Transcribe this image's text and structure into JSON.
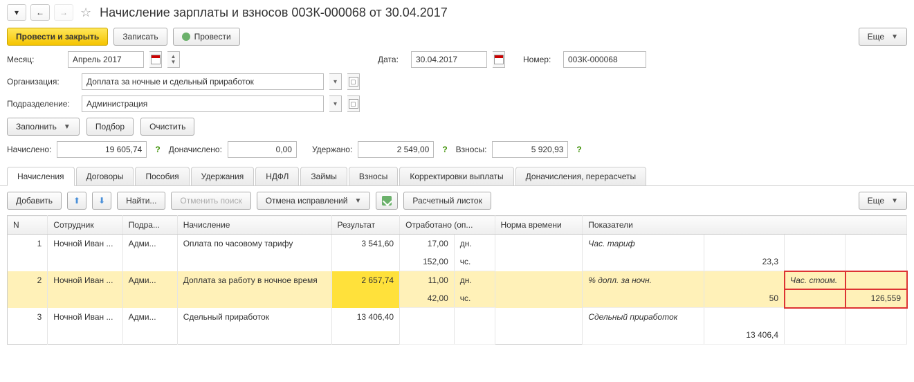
{
  "header": {
    "title": "Начисление зарплаты и взносов 00ЗК-000068 от 30.04.2017"
  },
  "toolbar": {
    "post_and_close": "Провести и закрыть",
    "save": "Записать",
    "post": "Провести",
    "more": "Еще"
  },
  "fields": {
    "month_label": "Месяц:",
    "month_value": "Апрель 2017",
    "date_label": "Дата:",
    "date_value": "30.04.2017",
    "number_label": "Номер:",
    "number_value": "00ЗК-000068",
    "org_label": "Организация:",
    "org_value": "Доплата за ночные и сдельный приработок",
    "dept_label": "Подразделение:",
    "dept_value": "Администрация"
  },
  "actions": {
    "fill": "Заполнить",
    "pick": "Подбор",
    "clear": "Очистить"
  },
  "totals": {
    "accrued_label": "Начислено:",
    "accrued_value": "19 605,74",
    "additional_label": "Доначислено:",
    "additional_value": "0,00",
    "withheld_label": "Удержано:",
    "withheld_value": "2 549,00",
    "contributions_label": "Взносы:",
    "contributions_value": "5 920,93"
  },
  "tabs": [
    "Начисления",
    "Договоры",
    "Пособия",
    "Удержания",
    "НДФЛ",
    "Займы",
    "Взносы",
    "Корректировки выплаты",
    "Доначисления, перерасчеты"
  ],
  "subtoolbar": {
    "add": "Добавить",
    "find": "Найти...",
    "cancel_search": "Отменить поиск",
    "cancel_corrections": "Отмена исправлений",
    "payslip": "Расчетный листок",
    "more": "Еще"
  },
  "columns": {
    "n": "N",
    "employee": "Сотрудник",
    "dept": "Подра...",
    "accrual": "Начисление",
    "result": "Результат",
    "worked": "Отработано (оп...",
    "norm": "Норма времени",
    "indicators": "Показатели"
  },
  "rows": [
    {
      "n": "1",
      "employee": "Ночной Иван ...",
      "dept": "Адми...",
      "accrual": "Оплата по часовому тарифу",
      "result": "3 541,60",
      "worked1_val": "17,00",
      "worked1_unit": "дн.",
      "worked2_val": "152,00",
      "worked2_unit": "чс.",
      "indicator1_name": "Час. тариф",
      "indicator1_val": "23,3",
      "selected": false
    },
    {
      "n": "2",
      "employee": "Ночной Иван ...",
      "dept": "Адми...",
      "accrual": "Доплата за работу в ночное время",
      "result": "2 657,74",
      "worked1_val": "11,00",
      "worked1_unit": "дн.",
      "worked2_val": "42,00",
      "worked2_unit": "чс.",
      "indicator1_name": "% допл. за ночн.",
      "indicator1_val": "50",
      "indicator2_name": "Час. стоим.",
      "indicator2_val": "126,559",
      "selected": true
    },
    {
      "n": "3",
      "employee": "Ночной Иван ...",
      "dept": "Адми...",
      "accrual": "Сдельный приработок",
      "result": "13 406,40",
      "worked1_val": "",
      "worked1_unit": "",
      "worked2_val": "",
      "worked2_unit": "",
      "indicator1_name": "Сдельный приработок",
      "indicator1_val": "13 406,4",
      "selected": false
    }
  ]
}
